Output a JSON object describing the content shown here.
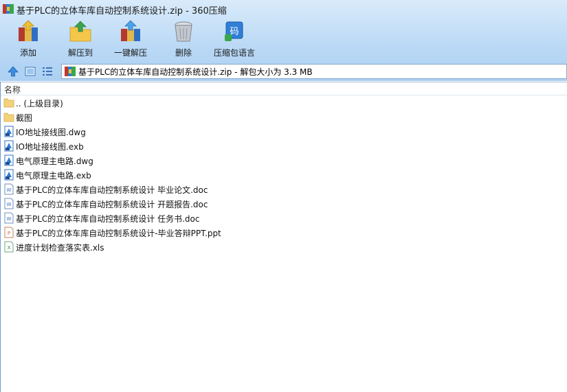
{
  "window": {
    "title": "基于PLC的立体车库自动控制系统设计.zip - 360压缩"
  },
  "toolbar": {
    "add_label": "添加",
    "extract_to_label": "解压到",
    "one_click_extract_label": "一键解压",
    "delete_label": "删除",
    "language_label": "压缩包语言"
  },
  "address": {
    "text": "基于PLC的立体车库自动控制系统设计.zip - 解包大小为 3.3 MB"
  },
  "columns": {
    "name_header": "名称"
  },
  "files": [
    {
      "name": ".. (上级目录)",
      "icon": "folder-icon"
    },
    {
      "name": "截图",
      "icon": "folder-icon"
    },
    {
      "name": "IO地址接线图.dwg",
      "icon": "cad-file-icon"
    },
    {
      "name": "IO地址接线图.exb",
      "icon": "cad-file-icon"
    },
    {
      "name": "电气原理主电路.dwg",
      "icon": "cad-file-icon"
    },
    {
      "name": "电气原理主电路.exb",
      "icon": "cad-file-icon"
    },
    {
      "name": "基于PLC的立体车库自动控制系统设计 毕业论文.doc",
      "icon": "word-file-icon"
    },
    {
      "name": "基于PLC的立体车库自动控制系统设计 开题报告.doc",
      "icon": "word-file-icon"
    },
    {
      "name": "基于PLC的立体车库自动控制系统设计 任务书.doc",
      "icon": "word-file-icon"
    },
    {
      "name": "基于PLC的立体车库自动控制系统设计-毕业答辩PPT.ppt",
      "icon": "ppt-file-icon"
    },
    {
      "name": "进度计划检查落实表.xls",
      "icon": "excel-file-icon"
    }
  ],
  "colors": {
    "accent": "#2f7fd6",
    "folder": "#f3d27a",
    "word": "#3b6fc4",
    "ppt": "#d2683a",
    "excel": "#2e8b3e"
  }
}
